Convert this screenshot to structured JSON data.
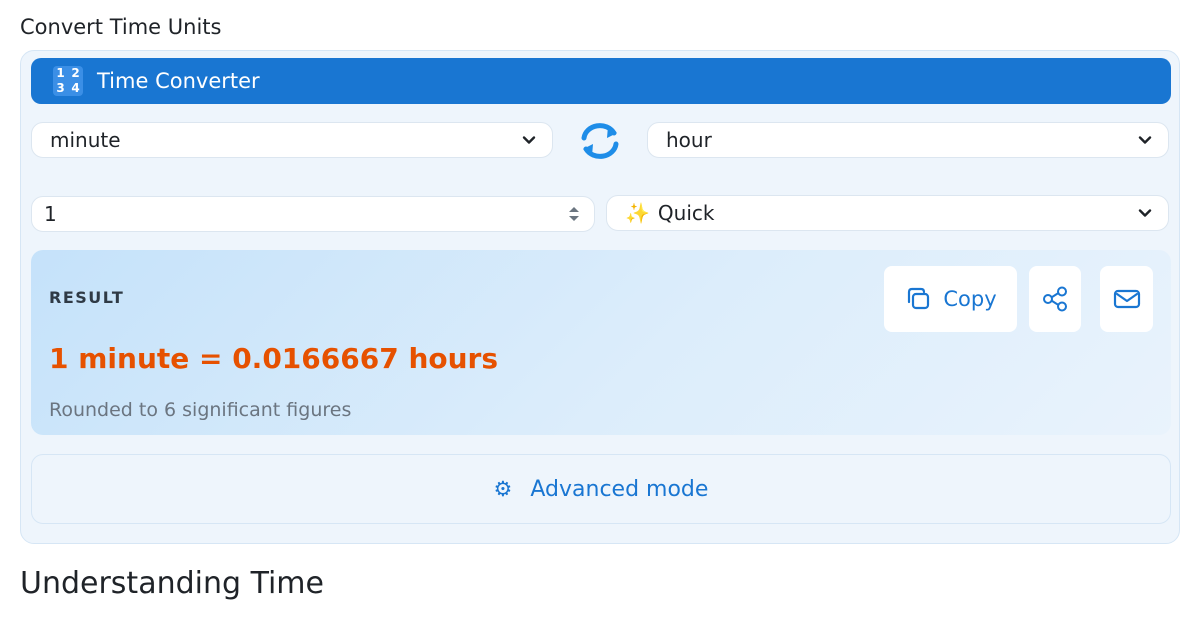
{
  "section_heading": "Convert Time Units",
  "converter": {
    "title": "Time Converter",
    "from_unit": "minute",
    "to_unit": "hour",
    "input_value": "1",
    "mode": "Quick"
  },
  "result": {
    "label": "RESULT",
    "value": "1 minute = 0.0166667 hours",
    "note": "Rounded to 6 significant figures",
    "copy_label": "Copy"
  },
  "advanced_label": "Advanced mode",
  "understanding_heading": "Understanding Time",
  "icons": {
    "title": "input-numbers-icon",
    "swap": "swap-arrows-icon",
    "mode": "sparkles-icon",
    "copy": "copy-icon",
    "share": "share-icon",
    "email": "email-icon",
    "advanced": "gear-icon"
  },
  "colors": {
    "accent": "#1976d2",
    "result_value": "#e65100",
    "card_background": "#eef5fc"
  }
}
